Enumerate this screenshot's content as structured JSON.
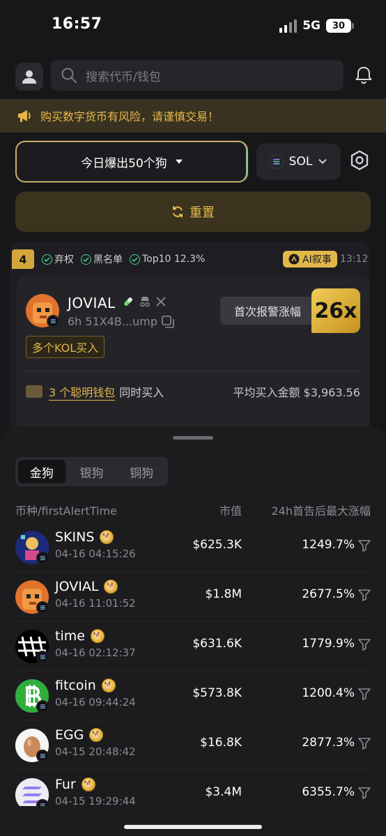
{
  "status": {
    "time": "16:57",
    "network": "5G",
    "battery": "30"
  },
  "header": {
    "search_placeholder": "搜索代币/钱包"
  },
  "banner": {
    "text": "购买数字货币有风险，请谨慎交易！"
  },
  "filters": {
    "main_label": "今日爆出50个狗",
    "chain_label": "SOL",
    "reset_label": "重置"
  },
  "alert_card": {
    "rank": "4",
    "tags": [
      "弃权",
      "黑名单",
      "Top10 12.3%"
    ],
    "ai_label": "AI叙事",
    "time": "13:12",
    "coin_name": "JOVIAL",
    "coin_meta": "6h 51X4B...ump",
    "kol_tag": "多个KOL买入",
    "first_alert_label": "首次报警涨幅",
    "multiplier": "26x",
    "smart_wallet_link": "3 个聪明钱包",
    "smart_wallet_suffix": "同时买入",
    "avg_buy": "平均买入金额 $3,963.56"
  },
  "tabs": {
    "items": [
      "金狗",
      "银狗",
      "铜狗"
    ],
    "active_index": 0
  },
  "table": {
    "headers": {
      "token": "币种/firstAlertTime",
      "mcap": "市值",
      "gain": "24h首告后最大涨幅"
    },
    "rows": [
      {
        "name": "SKINS",
        "datetime": "04-16 04:15:26",
        "mcap": "$625.3K",
        "gain": "1249.7%"
      },
      {
        "name": "JOVIAL",
        "datetime": "04-16 11:01:52",
        "mcap": "$1.8M",
        "gain": "2677.5%"
      },
      {
        "name": "time",
        "datetime": "04-16 02:12:37",
        "mcap": "$631.6K",
        "gain": "1779.9%"
      },
      {
        "name": "fitcoin",
        "datetime": "04-16 09:44:24",
        "mcap": "$573.8K",
        "gain": "1200.4%"
      },
      {
        "name": "EGG",
        "datetime": "04-15 20:48:42",
        "mcap": "$16.8K",
        "gain": "2877.3%"
      },
      {
        "name": "Fur",
        "datetime": "04-15 19:29:44",
        "mcap": "$3.4M",
        "gain": "6355.7%"
      }
    ]
  },
  "colors": {
    "accent_gold": "#e3b64d",
    "background": "#17171a",
    "sheet": "#1c1c1f",
    "check_green": "#3fd28c"
  },
  "icons": [
    "user-icon",
    "search-icon",
    "bell-icon",
    "megaphone-icon",
    "sol-icon",
    "settings-hex-icon",
    "refresh-icon",
    "check-icon",
    "ai-icon",
    "copy-icon",
    "x-icon",
    "wallet-icon",
    "funnel-icon",
    "medal-icon"
  ]
}
